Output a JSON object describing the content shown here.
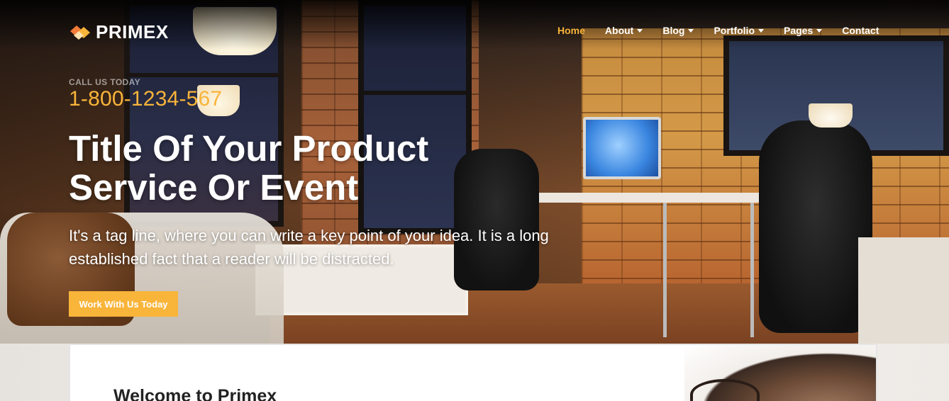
{
  "brand": {
    "name": "PRIMEX",
    "colors": {
      "accent": "#f9b43a",
      "text_light": "#ffffff",
      "heading_dark": "#222222"
    }
  },
  "nav": {
    "items": [
      {
        "label": "Home",
        "active": true,
        "dropdown": false
      },
      {
        "label": "About",
        "active": false,
        "dropdown": true
      },
      {
        "label": "Blog",
        "active": false,
        "dropdown": true
      },
      {
        "label": "Portfolio",
        "active": false,
        "dropdown": true
      },
      {
        "label": "Pages",
        "active": false,
        "dropdown": true
      },
      {
        "label": "Contact",
        "active": false,
        "dropdown": false
      }
    ]
  },
  "hero": {
    "call_label": "CALL US TODAY",
    "phone": "1-800-1234-567",
    "title_line1": "Title Of Your Product",
    "title_line2": "Service Or Event",
    "tagline": "It's a tag line, where you can write a key point of your idea. It is a long established fact that a reader will be distracted.",
    "cta_label": "Work With Us Today"
  },
  "welcome": {
    "title": "Welcome to Primex"
  },
  "icons": {
    "logo": "primex-logo-icon",
    "dropdown": "chevron-down-icon"
  }
}
